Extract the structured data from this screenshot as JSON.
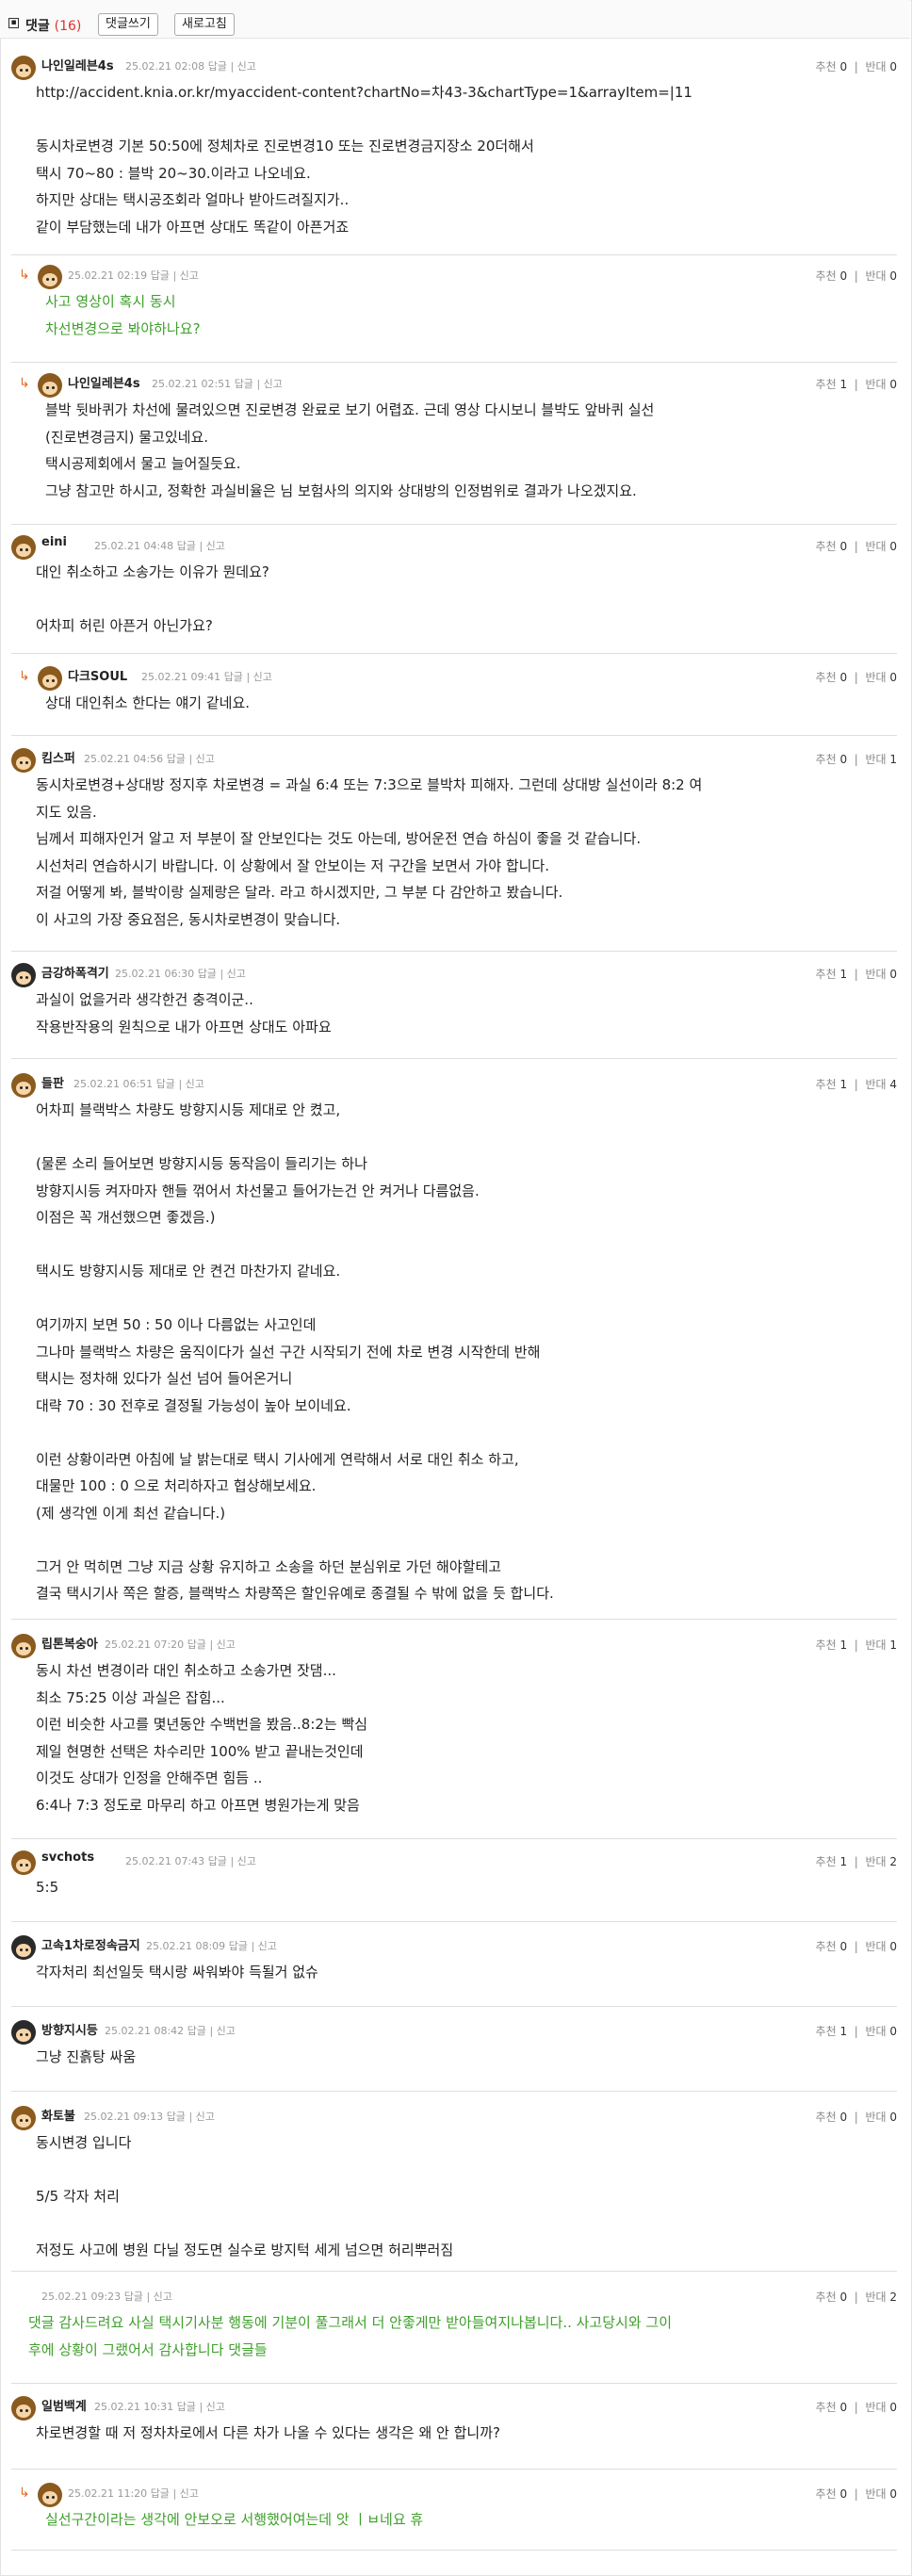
{
  "header": {
    "title": "댓글",
    "count": "(16)",
    "write_button": "댓글쓰기",
    "refresh_button": "새로고침"
  },
  "labels": {
    "reply": "답글",
    "report": "신고",
    "recommend": "추천",
    "oppose": "반대",
    "sep": "|"
  },
  "comments": [
    {
      "nick": "나인일레븐4s",
      "date": "25.02.21 02:08",
      "up": "0",
      "down": "0",
      "body": "http://accident.knia.or.kr/myaccident-content?chartNo=차43-3&chartType=1&arrayItem=|11\n\n동시차로변경 기본 50:50에 정체차로 진로변경10 또는 진로변경금지장소 20더해서\n택시 70~80 : 블박 20~30.이라고 나오네요.\n하지만 상대는 택시공조회라 얼마나 받아드려질지가..\n같이 부담했는데 내가 아프면 상대도 똑같이 아픈거죠"
    },
    {
      "nick": "",
      "date": "25.02.21 02:19",
      "up": "0",
      "down": "0",
      "body": "사고 영상이 혹시 동시\n차선변경으로 봐야하나요?"
    },
    {
      "nick": "나인일레븐4s",
      "date": "25.02.21 02:51",
      "up": "1",
      "down": "0",
      "body": "블박 뒷바퀴가 차선에 물려있으면 진로변경 완료로 보기 어렵죠. 근데 영상 다시보니 블박도 앞바퀴 실선\n(진로변경금지) 물고있네요.\n택시공제회에서 물고 늘어질듯요.\n그냥 참고만 하시고, 정확한 과실비율은 님 보험사의 의지와 상대방의 인정범위로 결과가 나오겠지요."
    },
    {
      "nick": "eini",
      "date": "25.02.21 04:48",
      "up": "0",
      "down": "0",
      "body": "대인 취소하고 소송가는 이유가 뭔데요?\n\n어차피 허린 아픈거 아닌가요?"
    },
    {
      "nick": "다크SOUL",
      "date": "25.02.21 09:41",
      "up": "0",
      "down": "0",
      "body": "상대 대인취소 한다는 얘기 같네요."
    },
    {
      "nick": "킴스퍼",
      "date": "25.02.21 04:56",
      "up": "0",
      "down": "1",
      "body": "동시차로변경+상대방 정지후 차로변경 = 과실 6:4 또는 7:3으로 블박차 피해자. 그런데 상대방 실선이라 8:2 여\n지도 있음.\n님께서 피해자인거 알고 저 부분이 잘 안보인다는 것도 아는데, 방어운전 연습 하심이 좋을 것 같습니다.\n시선처리 연습하시기 바랍니다. 이 상황에서 잘 안보이는 저 구간을 보면서 가야 합니다.\n저걸 어떻게 봐, 블박이랑 실제랑은 달라. 라고 하시겠지만, 그 부분 다 감안하고 봤습니다.\n이 사고의 가장 중요점은, 동시차로변경이 맞습니다."
    },
    {
      "nick": "금강하폭격기",
      "date": "25.02.21 06:30",
      "up": "1",
      "down": "0",
      "body": "과실이 없을거라 생각한건 충격이군..\n작용반작용의 원칙으로 내가 아프면 상대도 아파요"
    },
    {
      "nick": "들판",
      "date": "25.02.21 06:51",
      "up": "1",
      "down": "4",
      "body": "어차피 블랙박스 차량도 방향지시등 제대로 안 켰고,\n\n(물론 소리 들어보면 방향지시등 동작음이 들리기는 하나\n방향지시등 켜자마자 핸들 꺾어서 차선물고 들어가는건 안 켜거나 다름없음.\n이점은 꼭 개선했으면 좋겠음.)\n\n택시도 방향지시등 제대로 안 켠건 마찬가지 같네요.\n\n여기까지 보면 50 : 50 이나 다름없는 사고인데\n그나마 블랙박스 차량은 움직이다가 실선 구간 시작되기 전에 차로 변경 시작한데 반해\n택시는 정차해 있다가 실선 넘어 들어온거니\n대략 70 : 30 전후로 결정될 가능성이 높아 보이네요.\n\n이런 상황이라면 아침에 날 밝는대로 택시 기사에게 연락해서 서로 대인 취소 하고,\n대물만 100 : 0 으로 처리하자고 협상해보세요.\n(제 생각엔 이게 최선 같습니다.)\n\n그거 안 먹히면 그냥 지금 상황 유지하고 소송을 하던 분심위로 가던 해야할테고\n결국 택시기사 쪽은 할증, 블랙박스 차량쪽은 할인유예로 종결될 수 밖에 없을 듯 합니다."
    },
    {
      "nick": "립톤복숭아",
      "date": "25.02.21 07:20",
      "up": "1",
      "down": "1",
      "body": "동시 차선 변경이라 대인 취소하고 소송가면 잣댐...\n최소 75:25 이상 과실은 잡힘...\n이런 비슷한 사고를 몇년동안 수백번을 봤음..8:2는 빡심\n제일 현명한 선택은 차수리만 100% 받고 끝내는것인데\n이것도 상대가 인정을 안해주면 힘듬 ..\n6:4나 7:3 정도로 마무리 하고 아프면 병원가는게 맞음"
    },
    {
      "nick": "svchots",
      "date": "25.02.21 07:43",
      "up": "1",
      "down": "2",
      "body": "5:5"
    },
    {
      "nick": "고속1차로정속금지",
      "date": "25.02.21 08:09",
      "up": "0",
      "down": "0",
      "body": "각자처리 최선일듯 택시랑 싸워봐야 득될거 없슈"
    },
    {
      "nick": "방향지시등",
      "date": "25.02.21 08:42",
      "up": "1",
      "down": "0",
      "body": "그냥 진흙탕 싸움"
    },
    {
      "nick": "화토불",
      "date": "25.02.21 09:13",
      "up": "0",
      "down": "0",
      "body": "동시변경 입니다\n\n5/5 각자 처리\n\n저정도 사고에 병원 다닐 정도면 실수로 방지턱 세게 넘으면 허리뿌러짐"
    },
    {
      "nick": "",
      "date": "25.02.21 09:23",
      "up": "0",
      "down": "2",
      "body": "댓글 감사드려요 사실 택시기사분 행동에 기분이 풀그래서 더 안좋게만 받아들여지나봅니다.. 사고당시와 그이\n후에 상황이 그랬어서 감사합니다 댓글들"
    },
    {
      "nick": "일범백계",
      "date": "25.02.21 10:31",
      "up": "0",
      "down": "0",
      "body": "차로변경할 때 저 정차차로에서 다른 차가 나올 수 있다는 생각은 왜 안 합니까?"
    },
    {
      "nick": "",
      "date": "25.02.21 11:20",
      "up": "0",
      "down": "0",
      "body": "실선구간이라는 생각에 안보오로 서행했어여는데 앗 ㅣㅂ네요 휴"
    }
  ]
}
